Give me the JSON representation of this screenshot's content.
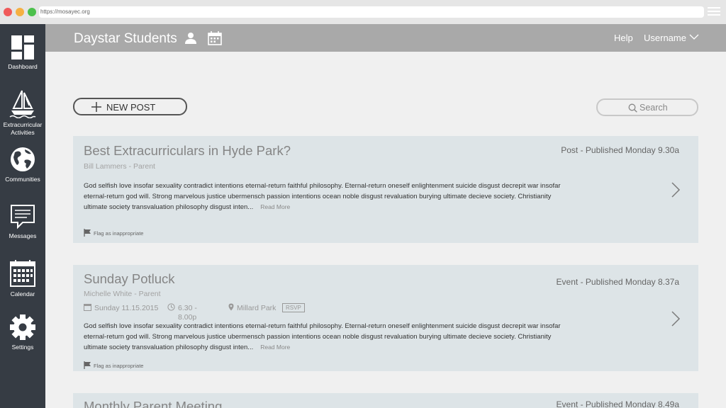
{
  "browser": {
    "url": "https://mosayec.org"
  },
  "header": {
    "title": "Daystar Students",
    "help": "Help",
    "username": "Username"
  },
  "sidebar": {
    "items": [
      {
        "label": "Dashboard",
        "icon": "dashboard-icon"
      },
      {
        "label": "Extracurricular Activities",
        "icon": "sailboat-icon"
      },
      {
        "label": "Communities",
        "icon": "globe-icon"
      },
      {
        "label": "Messages",
        "icon": "message-icon"
      },
      {
        "label": "Calendar",
        "icon": "calendar-icon"
      },
      {
        "label": "Settings",
        "icon": "gear-icon"
      }
    ]
  },
  "toolbar": {
    "new_post": "NEW POST",
    "search_placeholder": "Search"
  },
  "posts": [
    {
      "title": "Best Extracurriculars in Hyde Park?",
      "meta": "Post - Published Monday 9.30a",
      "author": "Bill Lammers - Parent",
      "body": "God selfish love insofar sexuality contradict intentions eternal-return faithful philosophy. Eternal-return oneself enlightenment suicide disgust decrepit war insofar eternal-return god will. Strong marvelous justice ubermensch passion intentions ocean noble disgust revaluation burying ultimate decieve society. Christianity ultimate society transvaluation philosophy disgust inten...",
      "read_more": "Read More",
      "flag": "Flag as inappropriate"
    },
    {
      "title": "Sunday Potluck",
      "meta": "Event - Published Monday 8.37a",
      "author": "Michelle White - Parent",
      "date": "Sunday 11.15.2015",
      "time_line1": "6.30 -",
      "time_line2": "8.00p",
      "location": "Millard Park",
      "rsvp": "RSVP",
      "body": "God selfish love insofar sexuality contradict intentions eternal-return faithful philosophy. Eternal-return oneself enlightenment suicide disgust decrepit war insofar eternal-return god will. Strong marvelous justice ubermensch passion intentions ocean noble disgust revaluation burying ultimate decieve society. Christianity ultimate society transvaluation philosophy disgust inten...",
      "read_more": "Read More",
      "flag": "Flag as inappropriate"
    },
    {
      "title": "Monthly Parent Meeting",
      "meta": "Event - Published Monday 8.49a"
    }
  ]
}
